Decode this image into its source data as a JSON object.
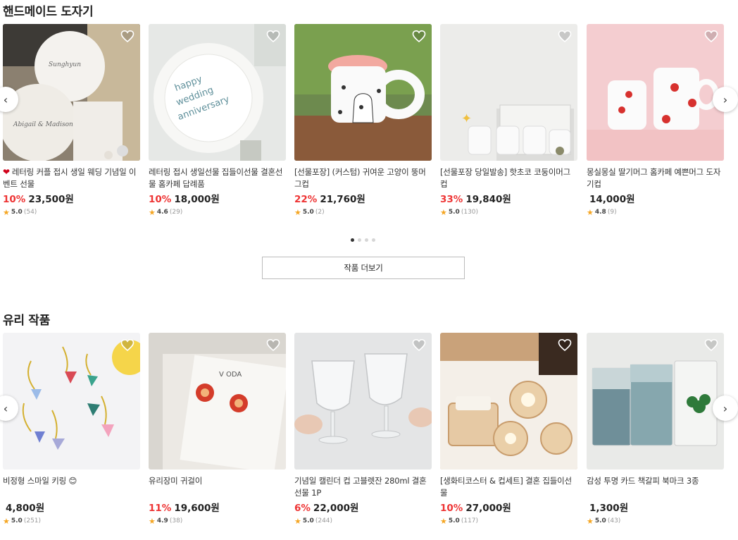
{
  "sections": [
    {
      "title": "핸드메이드 도자기",
      "products": [
        {
          "name": "레터링 커플 접시 생일 웨딩 기념일 이벤트 선물",
          "prefix": "❤",
          "discount": "10%",
          "price": "23,500원",
          "rating": "5.0",
          "count": "(54)"
        },
        {
          "name": "레터링 접시 생일선물 집들이선물 결혼선물 홈카페 답례품",
          "prefix": "",
          "discount": "10%",
          "price": "18,000원",
          "rating": "4.6",
          "count": "(29)"
        },
        {
          "name": "[선물포장] (커스텀) 귀여운 고양이 뚱머그컵",
          "prefix": "",
          "discount": "22%",
          "price": "21,760원",
          "rating": "5.0",
          "count": "(2)"
        },
        {
          "name": "[선물포장 당일발송] 핫초코 코둥이머그컵",
          "prefix": "",
          "discount": "33%",
          "price": "19,840원",
          "rating": "5.0",
          "count": "(130)"
        },
        {
          "name": "몽실몽실 딸기머그 홈카페 예쁜머그 도자기컵",
          "prefix": "",
          "discount": "",
          "price": "14,000원",
          "rating": "4.8",
          "count": "(9)"
        }
      ],
      "more_label": "작품 더보기"
    },
    {
      "title": "유리 작품",
      "products": [
        {
          "name": "비정형 스마일 키링 😊",
          "prefix": "",
          "discount": "",
          "price": "4,800원",
          "rating": "5.0",
          "count": "(251)"
        },
        {
          "name": "유리장미 귀걸이",
          "prefix": "",
          "discount": "11%",
          "price": "19,600원",
          "rating": "4.9",
          "count": "(38)"
        },
        {
          "name": "기념일 캘린더 컵 고블렛잔 280ml 결혼선물 1P",
          "prefix": "",
          "discount": "6%",
          "price": "22,000원",
          "rating": "5.0",
          "count": "(244)"
        },
        {
          "name": "[생화티코스터 & 컵세트] 결혼 집들이선물",
          "prefix": "",
          "discount": "10%",
          "price": "27,000원",
          "rating": "5.0",
          "count": "(117)"
        },
        {
          "name": "감성 투명 카드 책갈피 북마크 3종",
          "prefix": "",
          "discount": "",
          "price": "1,300원",
          "rating": "5.0",
          "count": "(43)"
        }
      ]
    }
  ],
  "icons": {
    "prev": "chevron-left-icon",
    "next": "chevron-right-icon",
    "wish": "heart-outline-icon",
    "star": "star-icon"
  },
  "colors": {
    "discount": "#ee3434",
    "star": "#f5a623"
  }
}
